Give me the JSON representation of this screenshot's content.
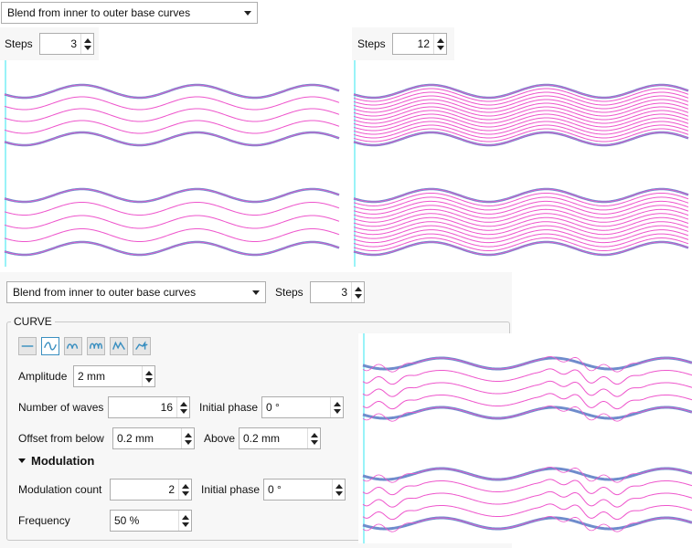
{
  "top": {
    "mode_dropdown": "Blend from inner to outer base curves",
    "left_preview": {
      "steps_label": "Steps",
      "steps": "3"
    },
    "right_preview": {
      "steps_label": "Steps",
      "steps": "12"
    }
  },
  "bottom": {
    "mode_dropdown": "Blend from inner to outer base curves",
    "steps_label": "Steps",
    "steps": "3",
    "curve_group": {
      "title": "CURVE",
      "shape_buttons": [
        {
          "icon": "straight-line-icon",
          "selected": false
        },
        {
          "icon": "sine-wave-icon",
          "selected": true
        },
        {
          "icon": "arc-wave-icon",
          "selected": false
        },
        {
          "icon": "loop-wave-icon",
          "selected": false
        },
        {
          "icon": "peak-wave-icon",
          "selected": false
        },
        {
          "icon": "custom-wave-icon",
          "selected": false
        }
      ],
      "amplitude_label": "Amplitude",
      "amplitude": "2 mm",
      "waves_label": "Number of waves",
      "waves": "16",
      "phase_label": "Initial phase",
      "phase": "0 °",
      "offset_label": "Offset  from below",
      "offset_below": "0.2 mm",
      "above_label": "Above",
      "offset_above": "0.2 mm",
      "modulation_header": "Modulation",
      "mod_count_label": "Modulation count",
      "mod_count": "2",
      "mod_phase_label": "Initial phase",
      "mod_phase": "0 °",
      "frequency_label": "Frequency",
      "frequency": "50 %"
    }
  },
  "colors": {
    "base_curve": "#6f8ccc",
    "blend_curve": "#ee55cc",
    "guide_line": "#99f3f8",
    "accent": "#3a8fc0"
  }
}
